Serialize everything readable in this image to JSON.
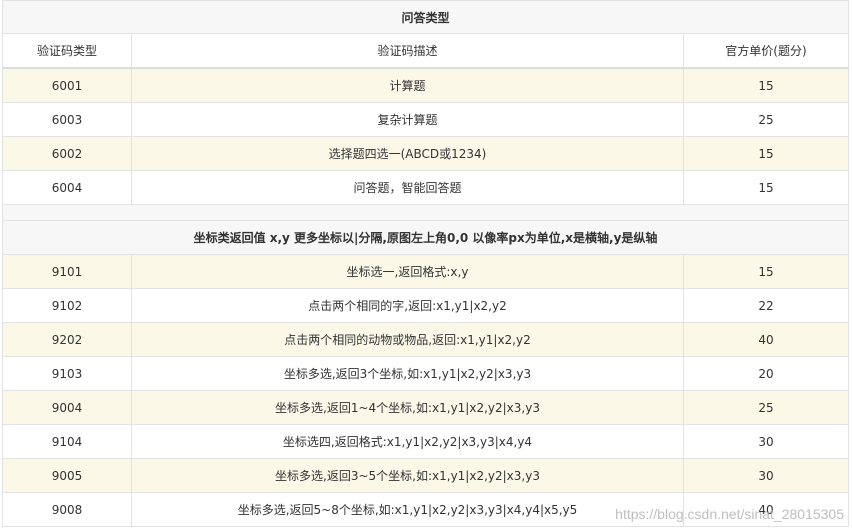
{
  "section1": {
    "title": "问答类型",
    "headers": [
      "验证码类型",
      "验证码描述",
      "官方单价(题分)"
    ],
    "rows": [
      [
        "6001",
        "计算题",
        "15"
      ],
      [
        "6003",
        "复杂计算题",
        "25"
      ],
      [
        "6002",
        "选择题四选一(ABCD或1234)",
        "15"
      ],
      [
        "6004",
        "问答题，智能回答题",
        "15"
      ]
    ]
  },
  "section2": {
    "title": "坐标类返回值 x,y 更多坐标以|分隔,原图左上角0,0 以像率px为单位,x是横轴,y是纵轴",
    "rows": [
      [
        "9101",
        "坐标选一,返回格式:x,y",
        "15"
      ],
      [
        "9102",
        "点击两个相同的字,返回:x1,y1|x2,y2",
        "22"
      ],
      [
        "9202",
        "点击两个相同的动物或物品,返回:x1,y1|x2,y2",
        "40"
      ],
      [
        "9103",
        "坐标多选,返回3个坐标,如:x1,y1|x2,y2|x3,y3",
        "20"
      ],
      [
        "9004",
        "坐标多选,返回1~4个坐标,如:x1,y1|x2,y2|x3,y3",
        "25"
      ],
      [
        "9104",
        "坐标选四,返回格式:x1,y1|x2,y2|x3,y3|x4,y4",
        "30"
      ],
      [
        "9005",
        "坐标多选,返回3~5个坐标,如:x1,y1|x2,y2|x3,y3",
        "30"
      ],
      [
        "9008",
        "坐标多选,返回5~8个坐标,如:x1,y1|x2,y2|x3,y3|x4,y4|x5,y5",
        "40"
      ]
    ]
  },
  "watermark": "https://blog.csdn.net/sinat_28015305"
}
